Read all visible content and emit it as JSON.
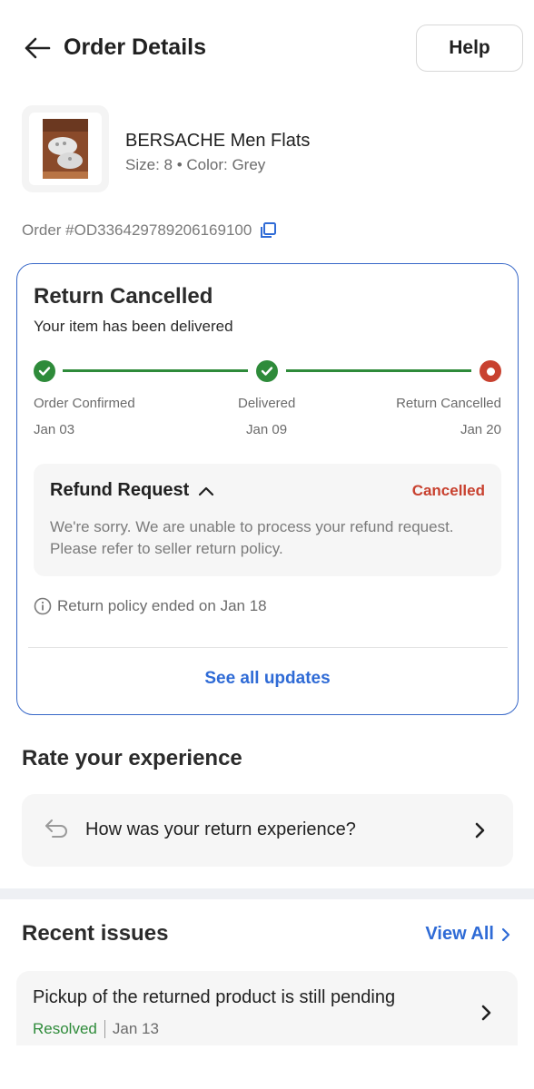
{
  "header": {
    "title": "Order Details",
    "help_label": "Help"
  },
  "product": {
    "name": "BERSACHE Men Flats",
    "meta": "Size: 8 • Color: Grey"
  },
  "order": {
    "id_text": "Order #OD336429789206169100"
  },
  "status": {
    "title": "Return Cancelled",
    "subtitle": "Your item has been delivered",
    "steps": [
      {
        "label": "Order Confirmed",
        "date": "Jan 03",
        "state": "done"
      },
      {
        "label": "Delivered",
        "date": "Jan 09",
        "state": "done"
      },
      {
        "label": "Return Cancelled",
        "date": "Jan 20",
        "state": "cancelled"
      }
    ],
    "refund": {
      "title": "Refund Request",
      "status": "Cancelled",
      "message": "We're sorry. We are unable to process your refund request. Please refer to seller return policy."
    },
    "policy_note": "Return policy ended on Jan 18",
    "see_all_label": "See all updates"
  },
  "rate": {
    "title": "Rate your experience",
    "question": "How was your return experience?"
  },
  "issues": {
    "title": "Recent issues",
    "view_all_label": "View All",
    "items": [
      {
        "text": "Pickup of the returned product is still pending",
        "status": "Resolved",
        "date": "Jan 13"
      }
    ]
  },
  "colors": {
    "accent_blue": "#2f6bd6",
    "card_border": "#3868c8",
    "success_green": "#2e8b3a",
    "error_red": "#c8412f"
  },
  "icons": [
    "back-arrow-icon",
    "copy-icon",
    "check-icon",
    "info-icon",
    "chevron-up-icon",
    "return-arrow-icon",
    "chevron-right-icon"
  ]
}
